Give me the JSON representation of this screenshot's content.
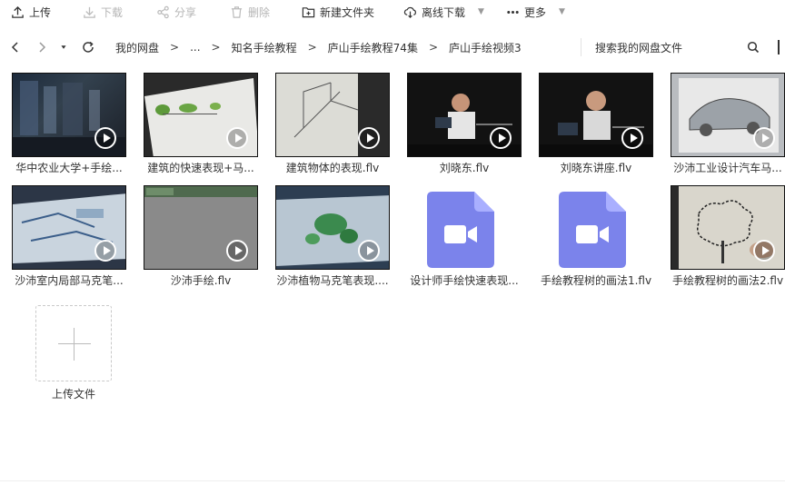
{
  "toolbar": {
    "upload": "上传",
    "download": "下载",
    "share": "分享",
    "delete": "删除",
    "new_folder": "新建文件夹",
    "offline_download": "离线下载",
    "more": "更多"
  },
  "nav": {
    "crumbs": [
      "我的网盘",
      "...",
      "知名手绘教程",
      "庐山手绘教程74集",
      "庐山手绘视频3"
    ],
    "separator": ">",
    "search_placeholder": "搜索我的网盘文件"
  },
  "files": [
    {
      "name": "华中农业大学+手绘...",
      "type": "video-thumb",
      "theme": "dark-blue"
    },
    {
      "name": "建筑的快速表现+马...",
      "type": "video-thumb",
      "theme": "paper-green"
    },
    {
      "name": "建筑物体的表现.flv",
      "type": "video-thumb",
      "theme": "sketch"
    },
    {
      "name": "刘晓东.flv",
      "type": "video-thumb",
      "theme": "person"
    },
    {
      "name": "刘晓东讲座.flv",
      "type": "video-thumb",
      "theme": "person"
    },
    {
      "name": "沙沛工业设计汽车马...",
      "type": "video-thumb",
      "theme": "car"
    },
    {
      "name": "沙沛室内局部马克笔...",
      "type": "video-thumb",
      "theme": "blue-sketch"
    },
    {
      "name": "沙沛手绘.flv",
      "type": "video-thumb",
      "theme": "gray"
    },
    {
      "name": "沙沛植物马克笔表现....",
      "type": "video-thumb",
      "theme": "blue-green"
    },
    {
      "name": "设计师手绘快速表现...",
      "type": "video-icon",
      "theme": "purple"
    },
    {
      "name": "手绘教程树的画法1.flv",
      "type": "video-icon",
      "theme": "purple"
    },
    {
      "name": "手绘教程树的画法2.flv",
      "type": "video-thumb",
      "theme": "tree"
    }
  ],
  "upload_tile": {
    "label": "上传文件"
  },
  "colors": {
    "video_icon": "#7b83eb",
    "video_icon_fold": "#a9afff"
  }
}
